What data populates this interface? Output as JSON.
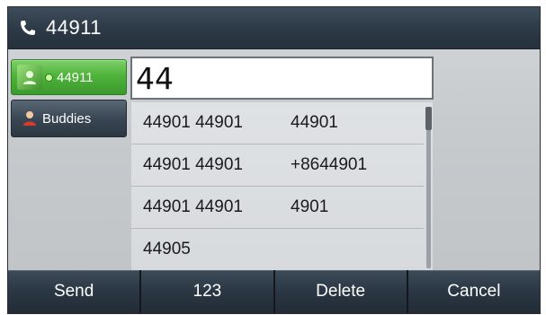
{
  "titlebar": {
    "icon": "phone-handset-icon",
    "title": "44911"
  },
  "sidebar": {
    "account": {
      "label": "44911",
      "status": "online",
      "icon": "account-avatar-icon"
    },
    "buddies": {
      "label": "Buddies",
      "icon": "person-icon"
    }
  },
  "dial_input": {
    "value": "44"
  },
  "results": [
    {
      "name": "44901 44901",
      "number": "44901"
    },
    {
      "name": "44901 44901",
      "number": "+8644901"
    },
    {
      "name": "44901 44901",
      "number": "4901"
    },
    {
      "name": "44905",
      "number": ""
    }
  ],
  "softkeys": {
    "send": "Send",
    "mode": "123",
    "delete": "Delete",
    "cancel": "Cancel"
  },
  "colors": {
    "account_green": "#4fb33b",
    "bar_dark": "#2a3643"
  }
}
